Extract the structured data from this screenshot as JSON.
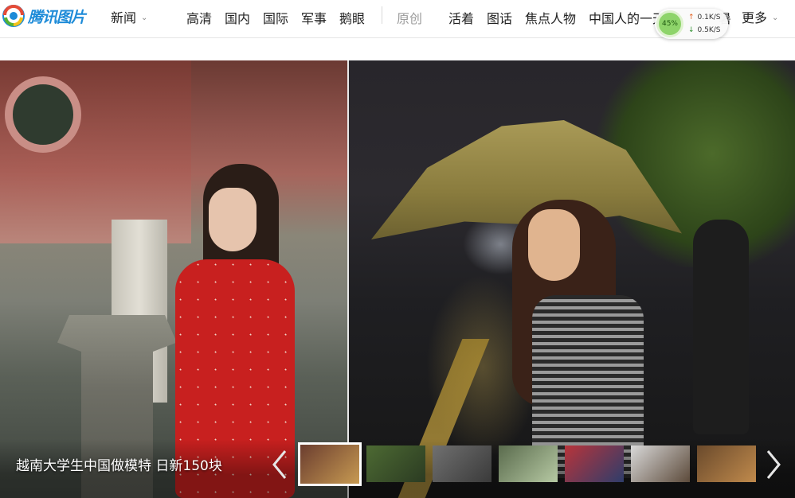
{
  "brand": {
    "name": "腾讯图片"
  },
  "channel": {
    "label": "新闻",
    "icon": "chevron-down-icon"
  },
  "nav": {
    "items": [
      "高清",
      "国内",
      "国际",
      "军事",
      "鹅眼"
    ],
    "special": "原创",
    "items2": [
      "活着",
      "图话",
      "焦点人物",
      "中国人的一天"
    ],
    "more_label": "更多",
    "truncated_suffix": "暑"
  },
  "speed_widget": {
    "percent": "45%",
    "upload": "0.1K/S",
    "download": "0.5K/S"
  },
  "gallery": {
    "caption": "越南大学生中国做模特 日新150块",
    "thumbnails": [
      {
        "name": "thumb-1",
        "colors": [
          "#6b3d2f",
          "#c79a52"
        ],
        "active": true
      },
      {
        "name": "thumb-2",
        "colors": [
          "#4d6a33",
          "#2b3b22"
        ],
        "active": false
      },
      {
        "name": "thumb-3",
        "colors": [
          "#707070",
          "#3a3a3a"
        ],
        "active": false
      },
      {
        "name": "thumb-4",
        "colors": [
          "#5a6b4d",
          "#b6c9a3"
        ],
        "active": false
      },
      {
        "name": "thumb-5",
        "colors": [
          "#b8343a",
          "#2e3d6b"
        ],
        "active": false
      },
      {
        "name": "thumb-6",
        "colors": [
          "#d9d9d9",
          "#5c4a3a"
        ],
        "active": false
      },
      {
        "name": "thumb-7",
        "colors": [
          "#6a4a2c",
          "#c08a4c"
        ],
        "active": false
      }
    ]
  },
  "colors": {
    "accent": "#1d8bd8",
    "nav_text": "#222222",
    "dim_text": "#9c9c9c"
  }
}
